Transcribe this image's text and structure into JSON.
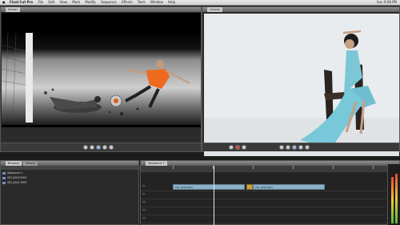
{
  "menubar": {
    "apple": "",
    "items": [
      "Final Cut Pro",
      "File",
      "Edit",
      "View",
      "Mark",
      "Modify",
      "Sequence",
      "Effects",
      "Tools",
      "Window",
      "Help"
    ],
    "status": "Sun 9:08 PM"
  },
  "viewer": {
    "tab": "Viewer"
  },
  "canvas": {
    "tab": "Canvas"
  },
  "browser": {
    "tabs": [
      "Browser",
      "Effects"
    ],
    "items": [
      {
        "name": "Sequence 1"
      },
      {
        "name": "VID_0019.MOV"
      },
      {
        "name": "VID_0021.MOV"
      }
    ]
  },
  "timeline": {
    "tab": "Sequence 1",
    "clips": [
      {
        "label": "VID_0019.MOV"
      },
      {
        "label": "VID_0021.MOV"
      }
    ],
    "track_labels": [
      "V1",
      "A1",
      "A2",
      "A3",
      "A4"
    ]
  },
  "colors": {
    "accent": "#8db1c7",
    "clip_gold": "#c9a34a",
    "record": "#d84b3c"
  }
}
